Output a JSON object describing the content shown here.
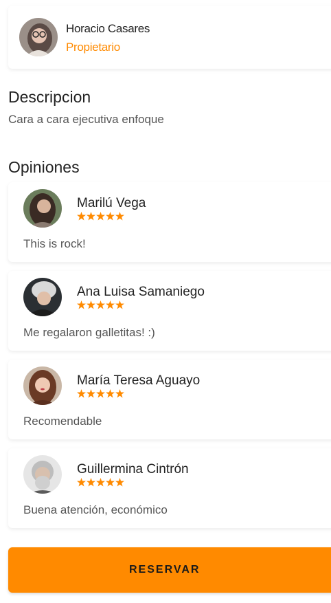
{
  "owner": {
    "name": "Horacio Casares",
    "role": "Propietario"
  },
  "description": {
    "title": "Descripcion",
    "text": "Cara a cara ejecutiva enfoque"
  },
  "opinions": {
    "title": "Opiniones",
    "rating_stars": 5,
    "items": [
      {
        "name": "Marilú Vega",
        "comment": "This is rock!"
      },
      {
        "name": "Ana Luisa Samaniego",
        "comment": "Me regalaron galletitas! :)"
      },
      {
        "name": "María Teresa Aguayo",
        "comment": "Recomendable"
      },
      {
        "name": "Guillermina Cintrón",
        "comment": "Buena atención, económico"
      }
    ]
  },
  "actions": {
    "reserve_label": "RESERVAR"
  },
  "colors": {
    "accent": "#ff8a00",
    "star": "#ff8a00"
  }
}
